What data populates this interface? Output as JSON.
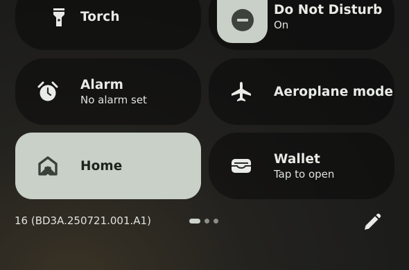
{
  "tiles": {
    "torch": {
      "title": "Torch",
      "icon": "flashlight-icon"
    },
    "dnd": {
      "title": "Do Not Disturb",
      "subtitle": "On",
      "icon": "do-not-disturb-icon"
    },
    "alarm": {
      "title": "Alarm",
      "subtitle": "No alarm set",
      "icon": "alarm-clock-icon"
    },
    "aeroplane": {
      "title": "Aeroplane mode",
      "icon": "aeroplane-icon"
    },
    "home": {
      "title": "Home",
      "icon": "home-icon"
    },
    "wallet": {
      "title": "Wallet",
      "subtitle": "Tap to open",
      "icon": "wallet-icon"
    }
  },
  "footer": {
    "build_number": "16 (BD3A.250721.001.A1)",
    "page_indicator": {
      "pages": 3,
      "current": 1
    },
    "edit_icon": "pencil-icon"
  },
  "colors": {
    "active_tile": "#c8d0c7",
    "inactive_tile": "#121212"
  }
}
